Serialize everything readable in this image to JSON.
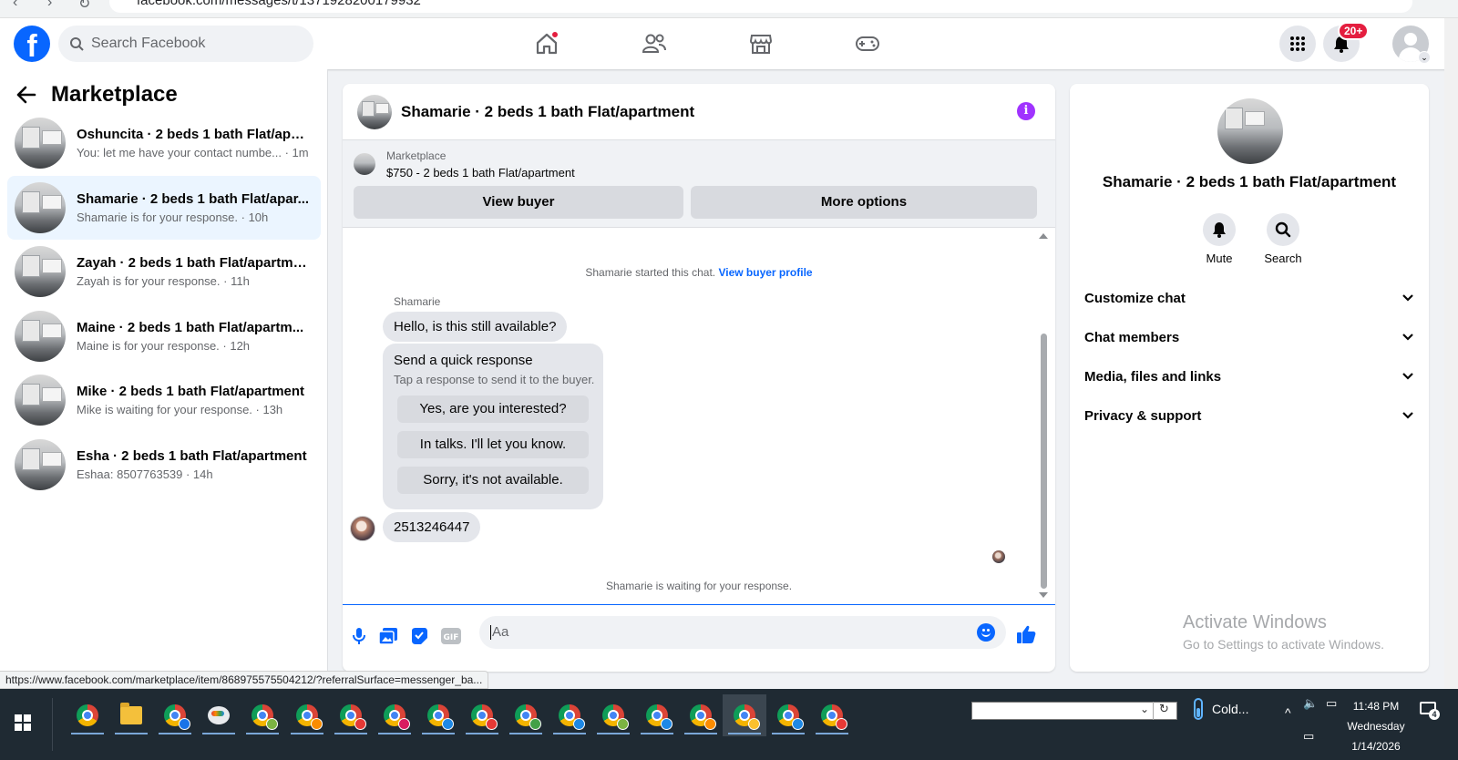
{
  "browser": {
    "url": "facebook.com/messages/t/1371928200179932"
  },
  "topbar": {
    "search_placeholder": "Search Facebook",
    "notifications_badge": "20+",
    "nav_icons": [
      "home-icon",
      "friends-icon",
      "marketplace-icon",
      "gaming-icon"
    ],
    "accent_color": "#0866ff"
  },
  "sidebar": {
    "title": "Marketplace",
    "conversations": [
      {
        "title": "Oshuncita · 2 beds 1 bath Flat/apar...",
        "subtitle": "You: let me have your contact numbe... · 1m",
        "active": false
      },
      {
        "title": "Shamarie · 2 beds 1 bath Flat/apar...",
        "subtitle": "Shamarie is for your response. · 10h",
        "active": true
      },
      {
        "title": "Zayah · 2 beds 1 bath Flat/apartme...",
        "subtitle": "Zayah is for your response. · 11h",
        "active": false
      },
      {
        "title": "Maine · 2 beds 1 bath Flat/apartm...",
        "subtitle": "Maine is for your response. · 12h",
        "active": false
      },
      {
        "title": "Mike · 2 beds 1 bath Flat/apartment",
        "subtitle": "Mike is waiting for your response. · 13h",
        "active": false
      },
      {
        "title": "Esha · 2 beds 1 bath Flat/apartment",
        "subtitle": "Eshaa: 8507763539 · 14h",
        "active": false
      }
    ]
  },
  "chat": {
    "title": "Shamarie · 2 beds 1 bath Flat/apartment",
    "listing": {
      "label": "Marketplace",
      "price_title": "$750 - 2 beds 1 bath Flat/apartment",
      "view_buyer": "View buyer",
      "more_options": "More options"
    },
    "started_text": "Shamarie started this chat.",
    "view_profile": "View buyer profile",
    "sender_name": "Shamarie",
    "first_message": "Hello, is this still available?",
    "quick": {
      "title": "Send a quick response",
      "subtitle": "Tap a response to send it to the buyer.",
      "options": [
        "Yes, are you interested?",
        "In talks. I'll let you know.",
        "Sorry, it's not available."
      ]
    },
    "second_message": "2513246447",
    "waiting_text": "Shamarie is waiting for your response.",
    "composer_placeholder": "Aa",
    "composer_icons": [
      "microphone-icon",
      "photo-icon",
      "sticker-icon",
      "gif-icon",
      "emoji-icon",
      "like-icon"
    ]
  },
  "right_panel": {
    "name": "Shamarie · 2 beds 1 bath Flat/apartment",
    "actions": [
      {
        "label": "Mute",
        "icon": "bell-icon"
      },
      {
        "label": "Search",
        "icon": "search-icon"
      }
    ],
    "sections": [
      "Customize chat",
      "Chat members",
      "Media, files and links",
      "Privacy & support"
    ]
  },
  "watermark": {
    "line1": "Activate Windows",
    "line2": "Go to Settings to activate Windows."
  },
  "status_url": "https://www.facebook.com/marketplace/item/868975575504212/?referralSurface=messenger_ba...",
  "taskbar": {
    "weather": "Cold...",
    "time": "11:48 PM",
    "day": "Wednesday",
    "date": "1/14/2026",
    "notification_count": "4"
  }
}
